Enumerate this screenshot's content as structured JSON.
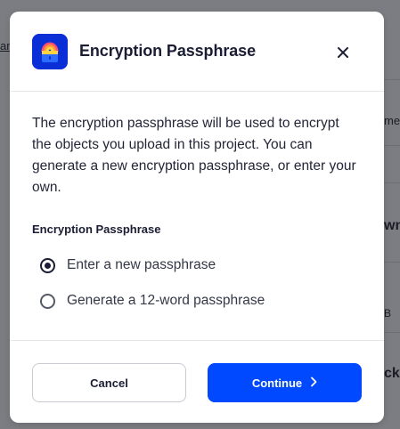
{
  "background": {
    "left_fragment": "ar",
    "right_fragments": [
      "me",
      "wn",
      "B",
      "ck"
    ]
  },
  "modal": {
    "title": "Encryption Passphrase",
    "description": "The encryption passphrase will be used to encrypt the objects you upload in this project. You can generate a new encryption passphrase, or enter your own.",
    "section_label": "Encryption Passphrase",
    "options": [
      {
        "label": "Enter a new passphrase",
        "selected": true
      },
      {
        "label": "Generate a 12-word passphrase",
        "selected": false
      }
    ],
    "cancel_label": "Cancel",
    "continue_label": "Continue",
    "icons": {
      "app": "lock-icon",
      "close": "close-icon",
      "continue": "chevron-right-icon"
    },
    "colors": {
      "primary": "#0149ff",
      "app_icon_bg": "#0a2fd6",
      "title": "#1a1d33"
    }
  }
}
